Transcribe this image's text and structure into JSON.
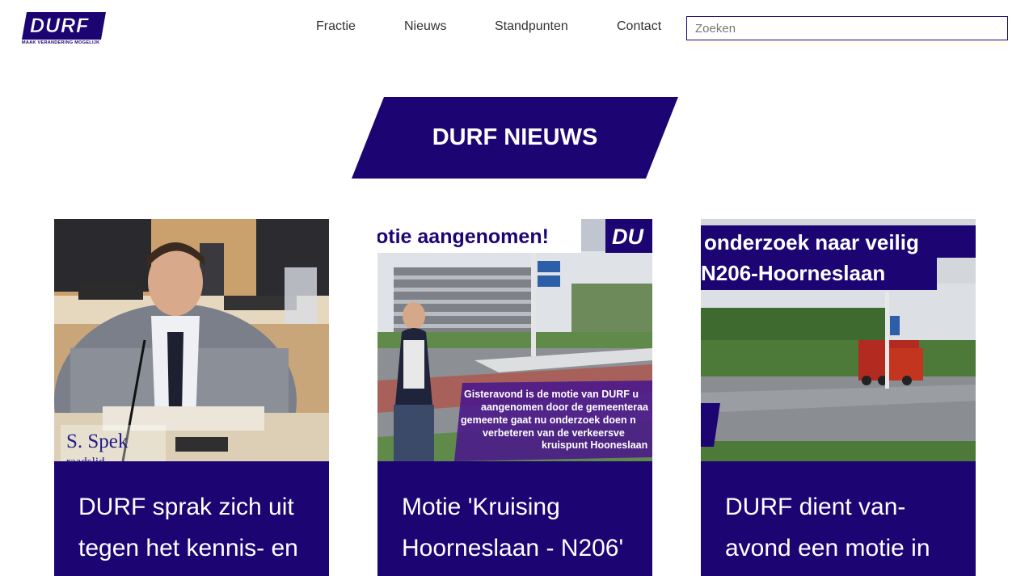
{
  "header": {
    "logo_text": "DURF",
    "logo_tagline": "MAAK VERANDERING MOGELIJK",
    "nav": [
      "Fractie",
      "Nieuws",
      "Standpunten",
      "Contact"
    ],
    "search_placeholder": "Zoeken"
  },
  "banner": {
    "title": "DURF NIEUWS"
  },
  "colors": {
    "brand": "#1c0473",
    "white": "#ffffff"
  },
  "cards": [
    {
      "title": "DURF sprak zich uit tegen het kennis- en",
      "image": {
        "caption_name": "S. Spek",
        "caption_role": "raadslid"
      }
    },
    {
      "title": "Motie 'Kruising Hoorneslaan - N206'",
      "image": {
        "banner_text": "otie aangenomen!",
        "logo_text": "DU",
        "overlay_lines": [
          "Gisteravond is de motie van DURF u",
          "aangenomen door de gemeenteraa",
          "gemeente gaat nu onderzoek doen n",
          "verbeteren van de verkeersve",
          "kruispunt Hooneslaan"
        ]
      }
    },
    {
      "title": "DURF dient van-avond een motie in",
      "image": {
        "banner_line1": "onderzoek naar veilig",
        "banner_line2": "N206-Hoorneslaan"
      }
    }
  ]
}
